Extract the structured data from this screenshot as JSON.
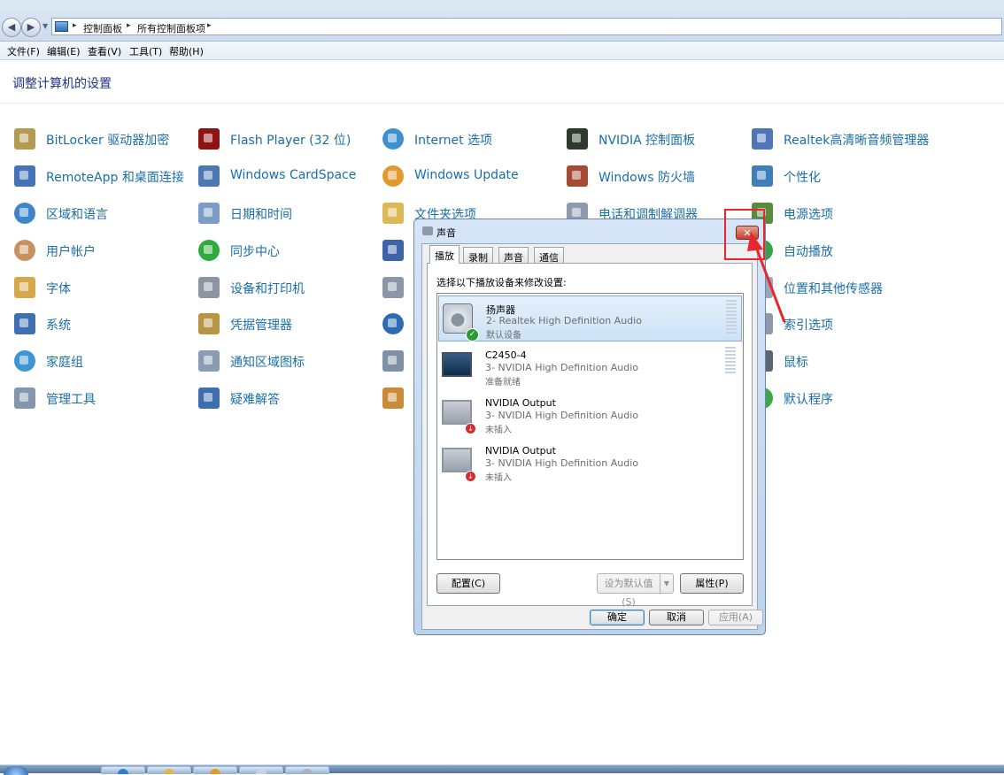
{
  "breadcrumb": [
    "控制面板",
    "所有控制面板项"
  ],
  "menu": [
    "文件(F)",
    "编辑(E)",
    "查看(V)",
    "工具(T)",
    "帮助(H)"
  ],
  "page_title": "调整计算机的设置",
  "control_panel": {
    "col1": [
      "BitLocker 驱动器加密",
      "RemoteApp 和桌面连接",
      "区域和语言",
      "用户帐户",
      "字体",
      "系统",
      "家庭组",
      "管理工具"
    ],
    "col2": [
      "Flash Player (32 位)",
      "Windows CardSpace",
      "日期和时间",
      "同步中心",
      "设备和打印机",
      "凭据管理器",
      "通知区域图标",
      "疑难解答"
    ],
    "col3": [
      "Internet 选项",
      "Windows Update",
      "文件夹选项"
    ],
    "col4": [
      "NVIDIA 控制面板",
      "Windows 防火墙",
      "电话和调制解调器"
    ],
    "col5": [
      "Realtek高清晰音频管理器",
      "个性化",
      "电源选项",
      "自动播放",
      "位置和其他传感器",
      "索引选项",
      "鼠标",
      "默认程序"
    ]
  },
  "dialog": {
    "title": "声音",
    "close_symbol": "✕",
    "tabs": [
      "播放",
      "录制",
      "声音",
      "通信"
    ],
    "instruction": "选择以下播放设备来修改设置:",
    "devices": [
      {
        "name": "扬声器",
        "description": "2- Realtek High Definition Audio",
        "status": "默认设备"
      },
      {
        "name": "C2450-4",
        "description": "3- NVIDIA High Definition Audio",
        "status": "准备就绪"
      },
      {
        "name": "NVIDIA Output",
        "description": "3- NVIDIA High Definition Audio",
        "status": "未插入"
      },
      {
        "name": "NVIDIA Output",
        "description": "3- NVIDIA High Definition Audio",
        "status": "未插入"
      }
    ],
    "buttons": {
      "configure": "配置(C)",
      "set_default": "设为默认值(S)",
      "properties": "属性(P)",
      "ok": "确定",
      "cancel": "取消",
      "apply": "应用(A)"
    }
  },
  "icons": {
    "nav_back": "◀",
    "nav_forward": "▶",
    "dropdown": "▼",
    "crumb_separator": "▸",
    "ok_badge": "✓",
    "unplugged_badge": "↓"
  },
  "colors": {
    "link": "#1a6ea8",
    "title": "#1e3287",
    "annotation": "#e8262e"
  }
}
